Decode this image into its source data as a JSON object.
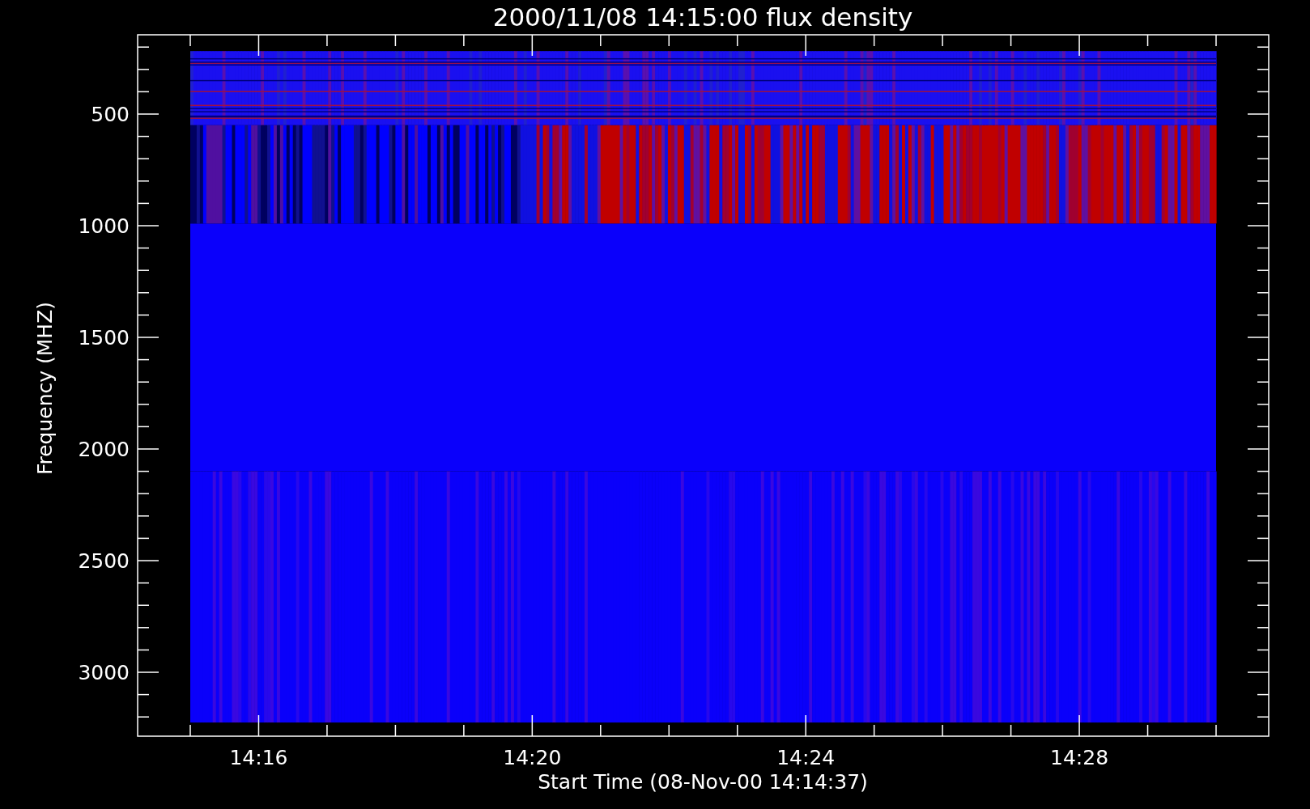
{
  "plot": {
    "title": "2000/11/08 14:15:00 flux density",
    "xlabel": "Start Time (08-Nov-00 14:14:37)",
    "ylabel": "Frequency (MHZ)",
    "y_tick_labels": [
      "500",
      "1000",
      "1500",
      "2000",
      "2500",
      "3000"
    ],
    "x_tick_labels": [
      "14:16",
      "14:20",
      "14:24",
      "14:28"
    ]
  }
}
